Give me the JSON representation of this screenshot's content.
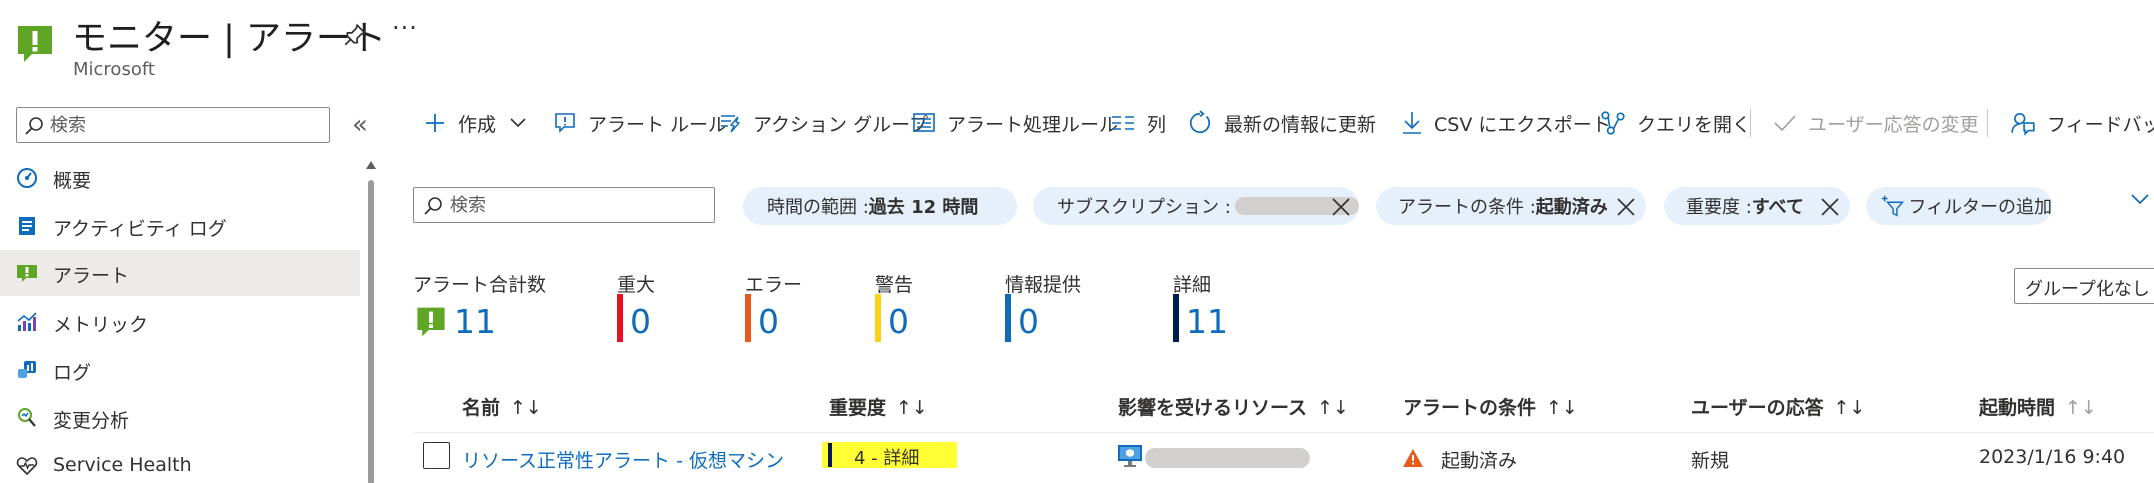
{
  "header": {
    "title": "モニター | アラート",
    "org": "Microsoft",
    "more": "···"
  },
  "sidebar": {
    "search_placeholder": "検索",
    "collapse": "«",
    "items": [
      {
        "label": "概要",
        "icon": "gauge-icon"
      },
      {
        "label": "アクティビティ ログ",
        "icon": "activity-log-icon"
      },
      {
        "label": "アラート",
        "icon": "alert-icon",
        "selected": true
      },
      {
        "label": "メトリック",
        "icon": "metrics-icon"
      },
      {
        "label": "ログ",
        "icon": "logs-icon"
      },
      {
        "label": "変更分析",
        "icon": "change-analysis-icon"
      },
      {
        "label": "Service Health",
        "icon": "heart-icon"
      }
    ]
  },
  "toolbar": {
    "create": "作成",
    "alert_rules": "アラート ルール",
    "action_groups": "アクション グループ",
    "processing_rules": "アラート処理ルール",
    "columns": "列",
    "refresh": "最新の情報に更新",
    "export_csv": "CSV にエクスポート",
    "open_query": "クエリを開く",
    "change_response": "ユーザー応答の変更",
    "feedback": "フィードバック"
  },
  "filters": {
    "search_placeholder": "検索",
    "time_range": {
      "label": "時間の範囲 : ",
      "value": "過去 12 時間"
    },
    "subscription": {
      "label": "サブスクリプション :"
    },
    "alert_condition": {
      "label": "アラートの条件 : ",
      "value": "起動済み"
    },
    "severity": {
      "label": "重要度 : ",
      "value": "すべて"
    },
    "add_filter": "フィルターの追加"
  },
  "summary": {
    "total": {
      "label": "アラート合計数",
      "value": "11"
    },
    "critical": {
      "label": "重大",
      "value": "0",
      "color": "#e81123"
    },
    "error": {
      "label": "エラー",
      "value": "0",
      "color": "#e8591c"
    },
    "warning": {
      "label": "警告",
      "value": "0",
      "color": "#fcd116"
    },
    "info": {
      "label": "情報提供",
      "value": "0",
      "color": "#0f6cbd"
    },
    "verbose": {
      "label": "詳細",
      "value": "11",
      "color": "#001b50"
    }
  },
  "group_by": "グループ化なし",
  "table": {
    "columns": [
      "名前",
      "重要度",
      "影響を受けるリソース",
      "アラートの条件",
      "ユーザーの応答",
      "起動時間"
    ],
    "sort_glyph": "↑↓",
    "rows": [
      {
        "name": "リソース正常性アラート - 仮想マシン",
        "severity": "4 - 詳細",
        "severity_color": "#001b50",
        "condition": "起動済み",
        "response": "新規",
        "fired": "2023/1/16 9:40"
      }
    ]
  }
}
